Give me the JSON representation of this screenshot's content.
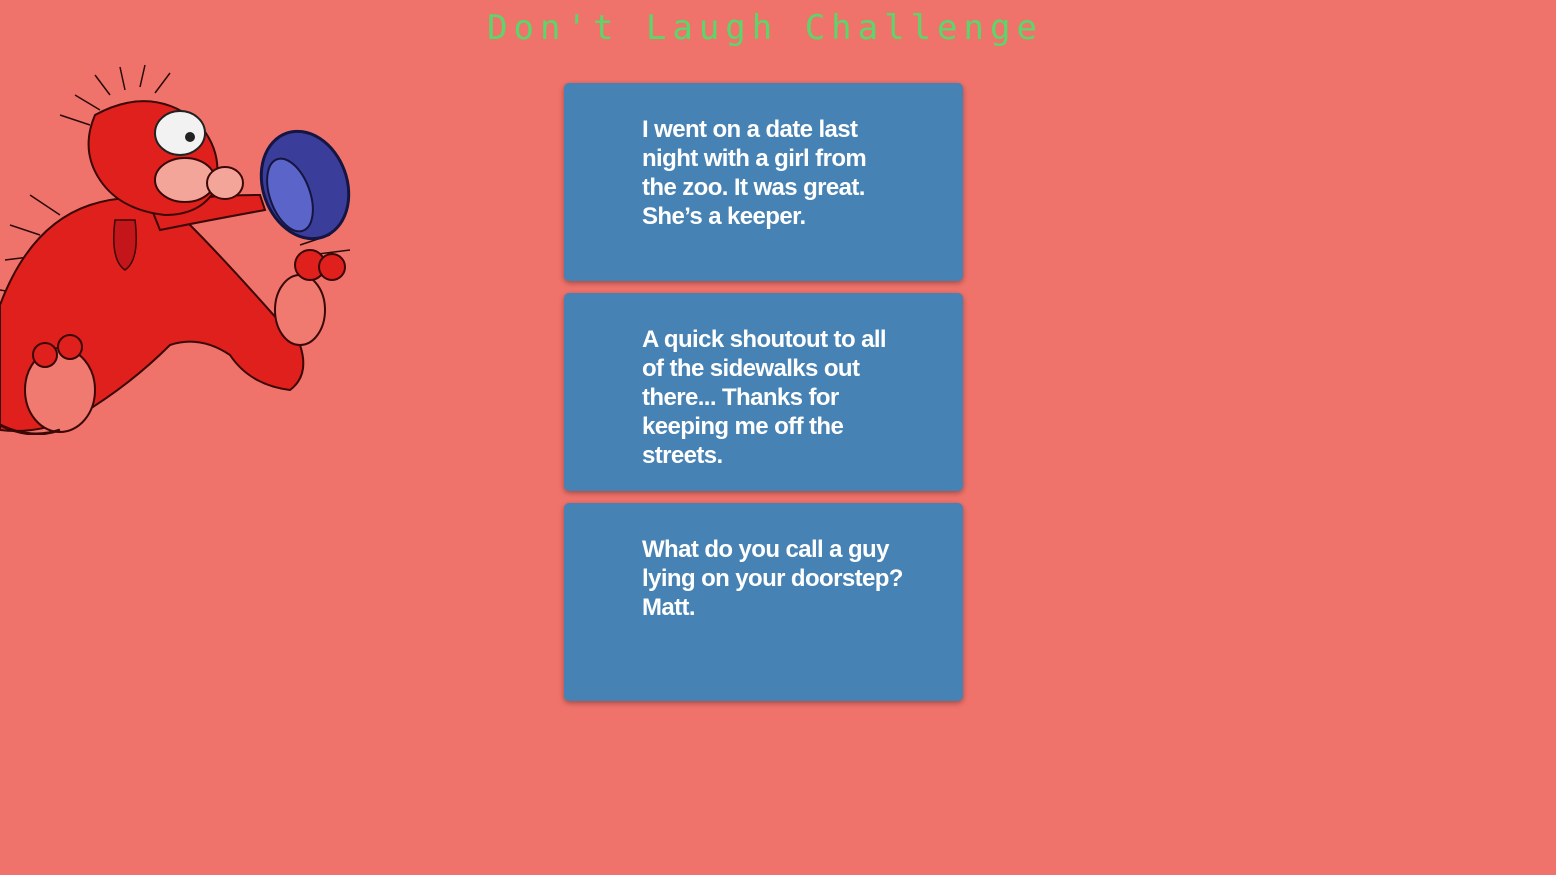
{
  "page": {
    "title": "Don't Laugh Challenge"
  },
  "jokes": [
    {
      "text": "I went on a date last night with a girl from the zoo. It was great. She’s a keeper."
    },
    {
      "text": "A quick shoutout to all of the sidewalks out there... Thanks for keeping me off the streets."
    },
    {
      "text": "What do you call a guy lying on your doorstep? Matt."
    }
  ],
  "colors": {
    "background": "#f0736b",
    "title": "#5cd66a",
    "card": "#4782b4",
    "card_text": "#ffffff"
  },
  "icons": {
    "mascot": "cartoon-cat-tipping-hat"
  }
}
